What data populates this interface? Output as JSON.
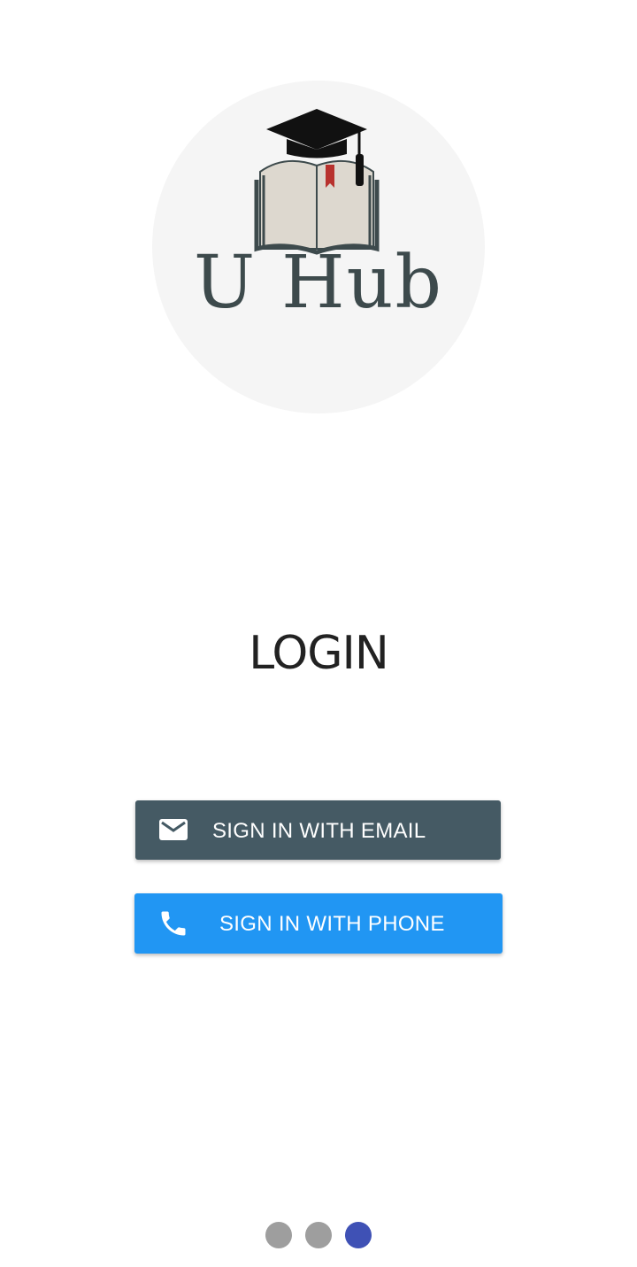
{
  "logo": {
    "text": "U Hub",
    "icon": "graduation-cap-book-icon"
  },
  "title": "LOGIN",
  "buttons": {
    "email": {
      "label": "SIGN IN WITH EMAIL",
      "icon": "mail-icon",
      "color": "#455a64"
    },
    "phone": {
      "label": "SIGN IN WITH PHONE",
      "icon": "phone-icon",
      "color": "#2196f3"
    }
  },
  "pager": {
    "pages": 3,
    "current": 3,
    "active_color": "#3f51b5",
    "inactive_color": "#9e9e9e"
  }
}
